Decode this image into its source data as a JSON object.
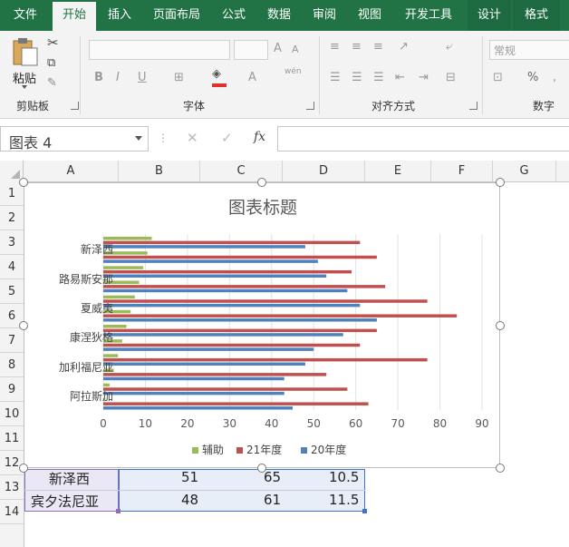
{
  "ribbon": {
    "tabs": [
      "文件",
      "开始",
      "插入",
      "页面布局",
      "公式",
      "数据",
      "审阅",
      "视图",
      "开发工具",
      "设计",
      "格式"
    ],
    "active_tab": "开始",
    "paste_label": "粘贴",
    "groups": {
      "clipboard": "剪贴板",
      "font": "字体",
      "alignment": "对齐方式",
      "number": "数字"
    },
    "number_format": "常规",
    "wen_label": "wén"
  },
  "formula_bar": {
    "name_box": "图表 4",
    "fx_label": "fx",
    "formula": ""
  },
  "columns": [
    "A",
    "B",
    "C",
    "D",
    "E",
    "F",
    "G"
  ],
  "rows": [
    "1",
    "2",
    "3",
    "4",
    "5",
    "6",
    "7",
    "8",
    "9",
    "10",
    "11",
    "12",
    "13",
    "14"
  ],
  "cells": {
    "r12": {
      "a": "新泽西",
      "b": "51",
      "c": "65",
      "d": "10.5"
    },
    "r13": {
      "a": "宾夕法尼亚",
      "b": "48",
      "c": "61",
      "d": "11.5"
    }
  },
  "chart_data": {
    "type": "bar",
    "orientation": "horizontal",
    "title": "图表标题",
    "categories": [
      "新泽西",
      "路易斯安那",
      "夏威夷",
      "康涅狄格",
      "加利福尼亚",
      "阿拉斯加"
    ],
    "category_labels_shown": [
      "新泽西",
      "路易斯安那",
      "夏威夷",
      "康涅狄格",
      "加利福尼亚",
      "阿拉斯加"
    ],
    "series": [
      {
        "name": "辅助",
        "color": "#9bbb59",
        "values": [
          11.5,
          10.5,
          9.5,
          8.5,
          7.5,
          6.5,
          5.5,
          4.5,
          3.5,
          2.5,
          1.5,
          0.5
        ]
      },
      {
        "name": "21年度",
        "color": "#c0504d",
        "values": [
          61,
          65,
          59,
          67,
          77,
          84,
          65,
          61,
          77,
          53,
          58,
          63
        ]
      },
      {
        "name": "20年度",
        "color": "#4f81bd",
        "values": [
          48,
          51,
          53,
          58,
          61,
          65,
          57,
          50,
          48,
          43,
          43,
          45
        ]
      }
    ],
    "xlim": [
      0,
      90
    ],
    "xticks": [
      "0",
      "10",
      "20",
      "30",
      "40",
      "50",
      "60",
      "70",
      "80",
      "90"
    ],
    "grid": true,
    "legend": "bottom"
  }
}
